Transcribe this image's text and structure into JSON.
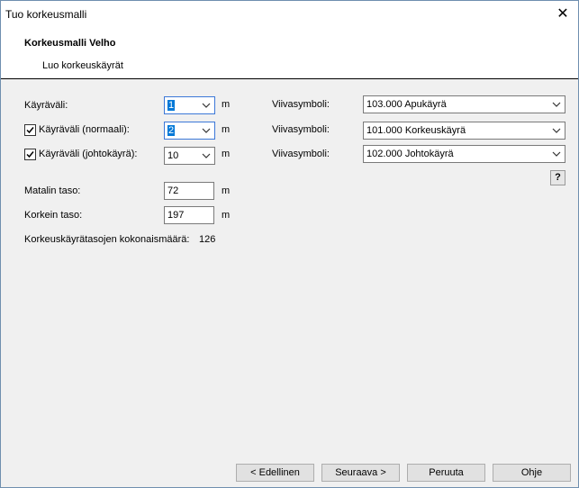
{
  "window": {
    "title": "Tuo korkeusmalli",
    "close_glyph": "✕"
  },
  "header": {
    "title": "Korkeusmalli Velho",
    "subtitle": "Luo korkeuskäyrät"
  },
  "rows": [
    {
      "label": "Käyräväli:",
      "checked": null,
      "value": "1",
      "unit": "m",
      "symbol_label": "Viivasymboli:",
      "symbol_value": "103.000 Apukäyrä"
    },
    {
      "label": "Käyräväli (normaali):",
      "checked": true,
      "value": "2",
      "unit": "m",
      "symbol_label": "Viivasymboli:",
      "symbol_value": "101.000 Korkeuskäyrä"
    },
    {
      "label": "Käyräväli (johtokäyrä):",
      "checked": true,
      "value": "10",
      "unit": "m",
      "symbol_label": "Viivasymboli:",
      "symbol_value": "102.000 Johtokäyrä"
    }
  ],
  "levels": {
    "min_label": "Matalin taso:",
    "min_value": "72",
    "min_unit": "m",
    "max_label": "Korkein taso:",
    "max_value": "197",
    "max_unit": "m"
  },
  "total": {
    "label": "Korkeuskäyrätasojen kokonaismäärä:",
    "value": "126"
  },
  "help_label": "?",
  "buttons": {
    "back": "< Edellinen",
    "next": "Seuraava >",
    "cancel": "Peruuta",
    "help": "Ohje"
  }
}
